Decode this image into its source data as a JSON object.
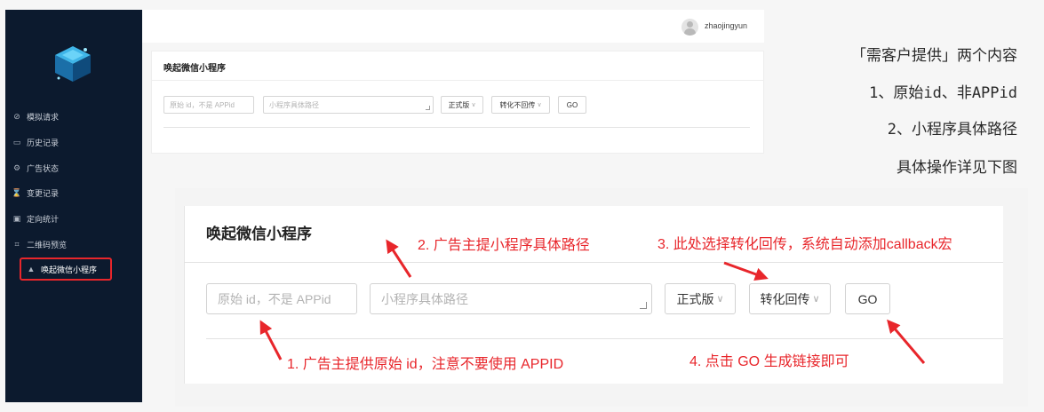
{
  "header": {
    "username": "zhaojingyun"
  },
  "sidebar": {
    "items": [
      {
        "label": "模拟请求",
        "icon": "link-icon"
      },
      {
        "label": "历史记录",
        "icon": "calendar-icon"
      },
      {
        "label": "广告状态",
        "icon": "gear-icon"
      },
      {
        "label": "变更记录",
        "icon": "hourglass-icon"
      },
      {
        "label": "定向统计",
        "icon": "chart-icon"
      },
      {
        "label": "二维码预览",
        "icon": "qrcode-icon"
      },
      {
        "label": "唤起微信小程序",
        "icon": "triangle-icon"
      }
    ]
  },
  "panel": {
    "title": "唤起微信小程序",
    "original_id_placeholder": "原始 id，不是 APPid",
    "path_placeholder": "小程序具体路径",
    "version_select": "正式版",
    "conversion_select": "转化不回传",
    "go_label": "GO"
  },
  "zoom_panel": {
    "title": "唤起微信小程序",
    "original_id_placeholder": "原始 id，不是 APPid",
    "path_placeholder": "小程序具体路径",
    "version_select": "正式版",
    "conversion_select": "转化回传",
    "go_label": "GO"
  },
  "notes": {
    "line1": "「需客户提供」两个内容",
    "line2": "1、原始id、非APPid",
    "line3": "2、小程序具体路径",
    "line4": "具体操作详见下图"
  },
  "annotations": {
    "step1": "1. 广告主提供原始 id，注意不要使用 APPID",
    "step2": "2. 广告主提小程序具体路径",
    "step3": "3. 此处选择转化回传，系统自动添加callback宏",
    "step4": "4. 点击 GO 生成链接即可"
  },
  "colors": {
    "sidebar_bg": "#0c1a2e",
    "annotation_red": "#e8262b"
  }
}
